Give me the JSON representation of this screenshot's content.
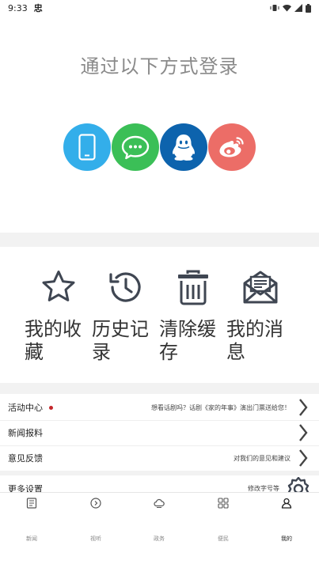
{
  "status_bar": {
    "time": "9:33",
    "app_glyph": "忠"
  },
  "login": {
    "title": "通过以下方式登录",
    "methods": [
      {
        "id": "phone",
        "icon": "phone-icon",
        "color": "#33aeea"
      },
      {
        "id": "wechat",
        "icon": "wechat-icon",
        "color": "#3bbf57"
      },
      {
        "id": "qq",
        "icon": "qq-penguin-icon",
        "color": "#0d63ad"
      },
      {
        "id": "weibo",
        "icon": "weibo-icon",
        "color": "#ec6d67"
      }
    ]
  },
  "quick_actions": [
    {
      "label": "我的收藏",
      "icon": "star-icon"
    },
    {
      "label": "历史记录",
      "icon": "history-clock-icon"
    },
    {
      "label": "清除缓存",
      "icon": "trash-icon"
    },
    {
      "label": "我的消息",
      "icon": "mail-icon"
    }
  ],
  "menu": {
    "activity": {
      "label": "活动中心",
      "desc": "想看话剧吗？话剧《家的年事》演出门票送给您！"
    },
    "news_report": {
      "label": "新闻报料",
      "desc": ""
    },
    "feedback": {
      "label": "意见反馈",
      "desc": "对我们的意见和建议"
    },
    "more_settings": {
      "label": "更多设置",
      "desc": "修改字号等"
    }
  },
  "tabs": [
    {
      "label": "新闻",
      "icon": "news-doc-icon",
      "active": false
    },
    {
      "label": "视听",
      "icon": "play-circle-icon",
      "active": false
    },
    {
      "label": "政务",
      "icon": "cloud-icon",
      "active": false
    },
    {
      "label": "便民",
      "icon": "grid-icon",
      "active": false
    },
    {
      "label": "我的",
      "icon": "user-icon",
      "active": true
    }
  ],
  "colors": {
    "accent_red": "#c4262b",
    "icon_gray": "#3f4652",
    "band": "#f2f2f2"
  }
}
